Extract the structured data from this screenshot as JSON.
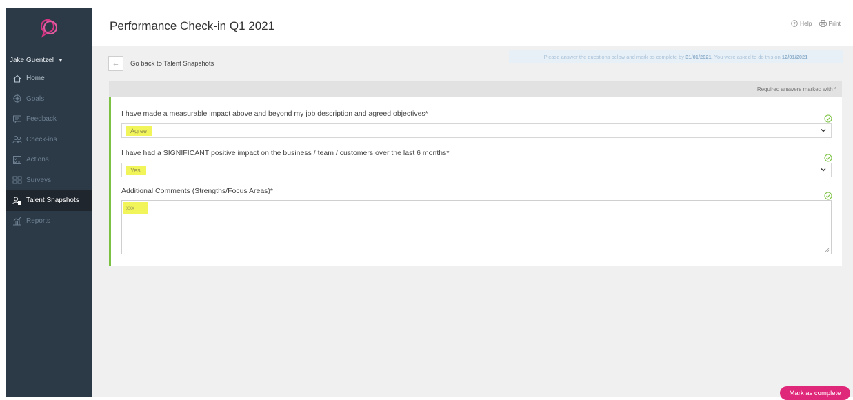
{
  "app": {
    "title": "Performance Check-in Q1 2021",
    "help_label": "Help",
    "print_label": "Print"
  },
  "sidebar": {
    "user_name": "Jake Guentzel",
    "items": [
      {
        "label": "Home",
        "icon": "home-icon"
      },
      {
        "label": "Goals",
        "icon": "target-icon"
      },
      {
        "label": "Feedback",
        "icon": "feedback-icon"
      },
      {
        "label": "Check-ins",
        "icon": "people-icon"
      },
      {
        "label": "Actions",
        "icon": "checklist-icon"
      },
      {
        "label": "Surveys",
        "icon": "survey-icon"
      },
      {
        "label": "Talent Snapshots",
        "icon": "talent-icon",
        "active": true
      },
      {
        "label": "Reports",
        "icon": "chart-icon"
      }
    ]
  },
  "main": {
    "back_label": "Go back to Talent Snapshots",
    "notice_prefix": "Please answer the questions below and mark as complete by ",
    "notice_due": "31/01/2021",
    "notice_mid": ". You were asked to do this on ",
    "notice_asked": "12/01/2021",
    "required_note": "Required answers marked with *",
    "questions": [
      {
        "label": "I have made a measurable impact above and beyond my job description and agreed objectives*",
        "value": "Agree"
      },
      {
        "label": "I have had a SIGNIFICANT positive impact on the business / team / customers over the last 6 months*",
        "value": "Yes"
      },
      {
        "label": "Additional Comments (Strengths/Focus Areas)*",
        "value": "xxx"
      }
    ],
    "complete_label": "Mark as complete"
  },
  "colors": {
    "sidebar_bg": "#2c3a47",
    "active_bg": "#20262d",
    "accent_green": "#7cc242",
    "highlight": "#f2f55a",
    "complete_button": "#e0287b"
  }
}
